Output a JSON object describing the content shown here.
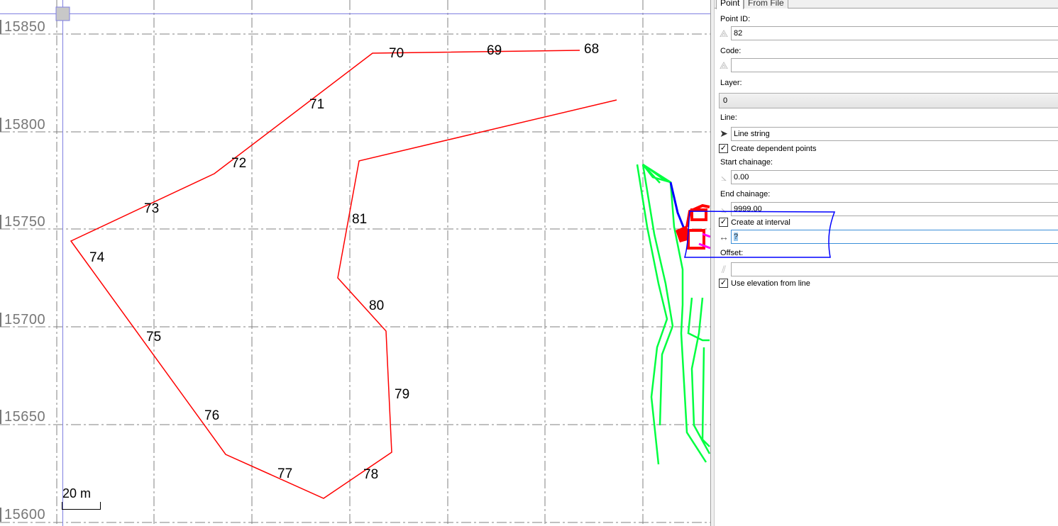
{
  "map": {
    "y_axis_labels": [
      "15850",
      "15800",
      "15750",
      "15700",
      "15650",
      "15600"
    ],
    "point_labels": [
      "68",
      "69",
      "70",
      "71",
      "72",
      "73",
      "74",
      "75",
      "76",
      "77",
      "78",
      "79",
      "80",
      "81"
    ],
    "scale_bar": "20 m",
    "colors": {
      "survey_line": "#ff0000",
      "detail": "#00ff40",
      "selection": "#0000ff",
      "grid": "#808080",
      "accent": "#ff00ff"
    }
  },
  "panel": {
    "tabs": [
      "Point",
      "From File"
    ],
    "point_id_label": "Point ID:",
    "point_id_value": "82",
    "code_label": "Code:",
    "code_value": "",
    "layer_label": "Layer:",
    "layer_value": "0",
    "line_label": "Line:",
    "line_value": "Line string",
    "create_dependent_label": "Create dependent points",
    "create_dependent_checked": true,
    "start_chainage_label": "Start chainage:",
    "start_chainage_value": "0.00",
    "end_chainage_label": "End chainage:",
    "end_chainage_value": "9999.00",
    "create_interval_label": "Create at interval",
    "create_interval_checked": true,
    "interval_value": "?",
    "offset_label": "Offset:",
    "offset_value": "",
    "use_elevation_label": "Use elevation from line",
    "use_elevation_checked": true
  }
}
